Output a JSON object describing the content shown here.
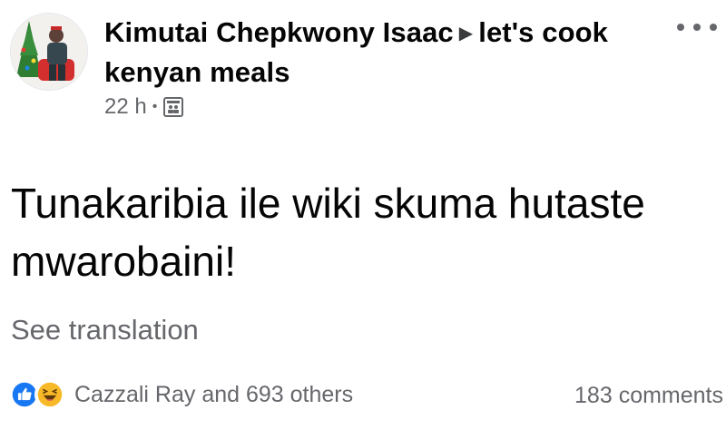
{
  "post": {
    "author": "Kimutai Chepkwony Isaac",
    "arrow_glyph": "▶",
    "group": "let's cook kenyan meals",
    "time": "22 h",
    "audience_icon": "group-audience-icon",
    "text": "Tunakaribia ile wiki skuma hutaste mwarobaini!",
    "see_translation": "See translation"
  },
  "reactions": {
    "icons": [
      "like-reaction-icon",
      "haha-reaction-icon"
    ],
    "summary": "Cazzali Ray and 693 others",
    "comments": "183 comments"
  },
  "colors": {
    "text_primary": "#050505",
    "text_secondary": "#65676b",
    "like_blue": "#1877f2",
    "haha_yellow": "#f7b928"
  }
}
